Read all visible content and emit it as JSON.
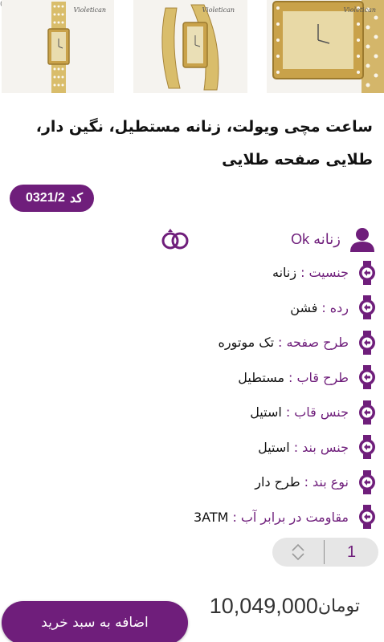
{
  "edge_mark": "0",
  "thumbnails": [
    {
      "name": "watch-thumb-front",
      "brand": "Violetican"
    },
    {
      "name": "watch-thumb-angle",
      "brand": "Violetican"
    },
    {
      "name": "watch-thumb-closeup",
      "brand": "Violetican"
    }
  ],
  "product": {
    "title": "ساعت مچی ویولت، زنانه مستطیل، نگین دار، طلایی صفحه طلایی",
    "code_label": "کد",
    "code_value": "0321/2",
    "gender_label": "زنانه Ok"
  },
  "specs": [
    {
      "label": "جنسیت",
      "value": "زنانه"
    },
    {
      "label": "رده",
      "value": "فشن"
    },
    {
      "label": "طرح صفحه",
      "value": "تک موتوره"
    },
    {
      "label": "طرح قاب",
      "value": "مستطیل"
    },
    {
      "label": "جنس قاب",
      "value": "استیل"
    },
    {
      "label": "جنس بند",
      "value": "استیل"
    },
    {
      "label": "نوع بند",
      "value": "طرح دار"
    },
    {
      "label": "مقاومت در برابر آب",
      "value": "3ATM"
    }
  ],
  "quantity": "1",
  "price": {
    "amount": "10,049,000",
    "currency": "تومان"
  },
  "cart_button": "اضافه به سبد خرید",
  "colors": {
    "accent": "#6f1e7b",
    "gold": "#c9a24a",
    "qty_bg": "#e6e6e6"
  },
  "icons": [
    "user-icon",
    "rings-icon",
    "watch-icon",
    "chevron-up-icon",
    "chevron-down-icon"
  ]
}
